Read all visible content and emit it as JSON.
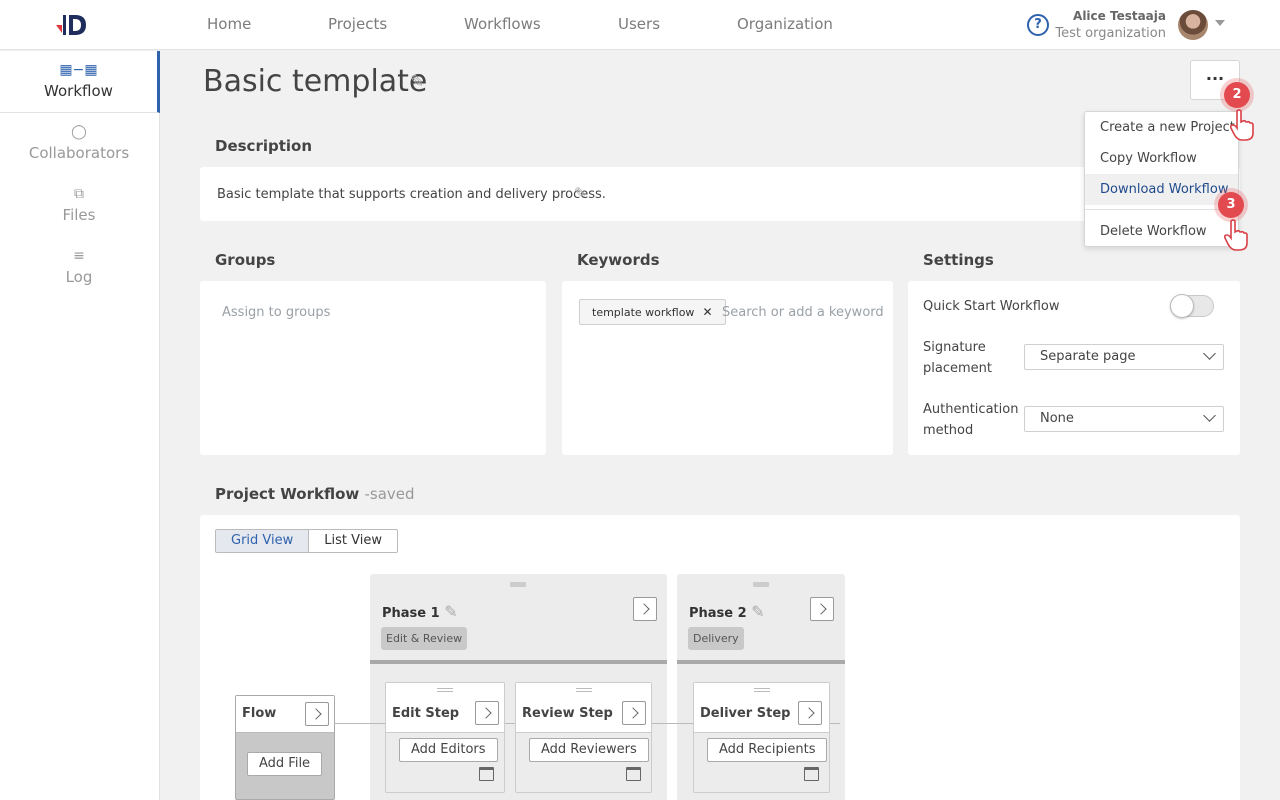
{
  "nav": {
    "items": [
      "Home",
      "Projects",
      "Workflows",
      "Users",
      "Organization"
    ]
  },
  "user": {
    "name": "Alice Testaaja",
    "organization": "Test organization"
  },
  "sidebar": {
    "items": [
      {
        "label": "Workflow",
        "icon": "workflow-icon",
        "active": true
      },
      {
        "label": "Collaborators",
        "icon": "person-icon",
        "active": false
      },
      {
        "label": "Files",
        "icon": "files-icon",
        "active": false
      },
      {
        "label": "Log",
        "icon": "log-icon",
        "active": false
      }
    ]
  },
  "page": {
    "title": "Basic template",
    "more_label": "..."
  },
  "description": {
    "label": "Description",
    "text": "Basic template that supports creation and delivery process."
  },
  "groups": {
    "label": "Groups",
    "placeholder": "Assign to groups"
  },
  "keywords": {
    "label": "Keywords",
    "chips": [
      "template workflow"
    ],
    "placeholder": "Search or add a keyword"
  },
  "settings": {
    "label": "Settings",
    "quick_start_label": "Quick Start Workflow",
    "quick_start_on": false,
    "signature_label_1": "Signature",
    "signature_label_2": "placement",
    "signature_value": "Separate page",
    "auth_label_1": "Authentication",
    "auth_label_2": "method",
    "auth_value": "None"
  },
  "menu": {
    "items": [
      "Create a new Project",
      "Copy Workflow",
      "Download Workflow",
      "Delete Workflow"
    ],
    "highlighted": "Download Workflow"
  },
  "badges": [
    "2",
    "3"
  ],
  "workflow": {
    "label": "Project Workflow",
    "status": "-saved",
    "views": [
      "Grid View",
      "List View"
    ],
    "active_view": "Grid View",
    "flow": {
      "name": "Flow",
      "button": "Add File"
    },
    "phases": [
      {
        "name": "Phase 1",
        "tag": "Edit & Review"
      },
      {
        "name": "Phase 2",
        "tag": "Delivery"
      }
    ],
    "steps": [
      {
        "name": "Edit Step",
        "button": "Add Editors"
      },
      {
        "name": "Review Step",
        "button": "Add Reviewers"
      },
      {
        "name": "Deliver Step",
        "button": "Add Recipients"
      }
    ]
  },
  "colors": {
    "accent": "#2e62ad",
    "badge": "#e24a4f",
    "logo_dark": "#1f2d5c",
    "logo_red": "#e03a3e"
  }
}
